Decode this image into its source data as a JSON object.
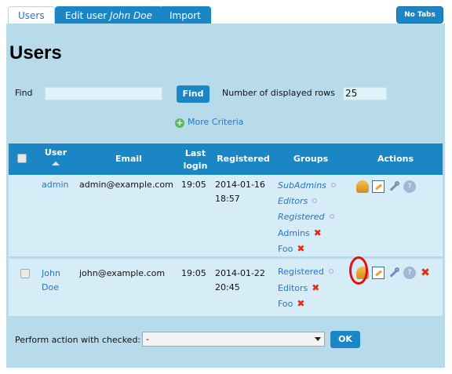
{
  "tabs": [
    {
      "label": "Users"
    },
    {
      "label_prefix": "Edit user ",
      "label_name": "John Doe"
    },
    {
      "label": "Import"
    }
  ],
  "no_tabs_label": "No Tabs",
  "page_title": "Users",
  "search": {
    "find_label": "Find",
    "find_value": "",
    "find_button": "Find",
    "rows_label": "Number of displayed rows",
    "rows_value": "25",
    "more_criteria": "More Criteria"
  },
  "table": {
    "headers": {
      "user": "User",
      "email": "Email",
      "last_login_1": "Last",
      "last_login_2": "login",
      "registered": "Registered",
      "groups": "Groups",
      "actions": "Actions"
    },
    "rows": [
      {
        "user_line1": "admin",
        "user_line2": "",
        "email": "admin@example.com",
        "last_login": "19:05",
        "registered_date": "2014-01-16",
        "registered_time": "18:57",
        "groups": [
          "SubAdmins",
          "Editors",
          "Registered",
          "Admins",
          "Foo"
        ]
      },
      {
        "user_line1": "John",
        "user_line2": "Doe",
        "email": "john@example.com",
        "last_login": "19:05",
        "registered_date": "2014-01-22",
        "registered_time": "20:45",
        "groups": [
          "Registered",
          "Editors",
          "Foo"
        ]
      }
    ]
  },
  "footer": {
    "action_label": "Perform action with checked:",
    "action_value": "-",
    "ok_button": "OK"
  },
  "colors": {
    "panel": "#b8dbec",
    "header": "#1b86c6",
    "row": "#d6ecf6",
    "link": "#2a74c4",
    "highlight": "#e01010"
  }
}
